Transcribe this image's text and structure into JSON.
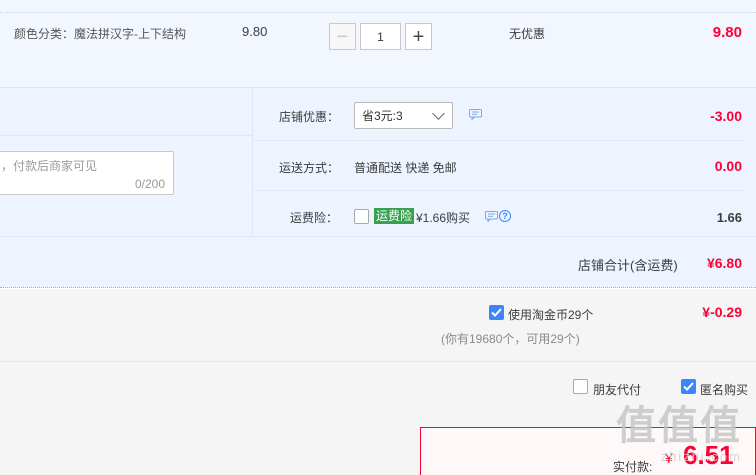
{
  "item": {
    "attr_label": "颜色分类：",
    "attr_value": "魔法拼汉字-上下结构",
    "unit_price": "9.80",
    "quantity": "1",
    "minus_glyph": "−",
    "plus_glyph": "+",
    "discount_text": "无优惠",
    "total": "9.80"
  },
  "store": {
    "memo_placeholder": "，付款后商家可见",
    "memo_count": "0/200",
    "coupon_label": "店铺优惠：",
    "coupon_selected": "省3元:3",
    "coupon_amount": "-3.00",
    "shipping_label": "运送方式：",
    "shipping_value": "普通配送 快递 免邮",
    "shipping_amount": "0.00",
    "insurance_label": "运费险：",
    "insurance_tag": "运费险",
    "insurance_price": "¥1.66购买",
    "insurance_amount": "1.66",
    "help_glyph": "?",
    "store_total_label": "店铺合计(含运费)",
    "store_total": "¥6.80"
  },
  "bottom": {
    "gold_label": "使用淘金币29个",
    "gold_amount": "¥-0.29",
    "gold_sub": "(你有19680个，可用29个)",
    "friend_pay_label": "朋友代付",
    "anonymous_label": "匿名购买",
    "pay_label": "实付款:",
    "pay_yen": "¥",
    "pay_amount": "6.51"
  },
  "watermark": {
    "logo": "值值值",
    "url": "zhizhi.com"
  },
  "colors": {
    "accent_red": "#ff0036",
    "checkbox_blue": "#3b86ff",
    "tag_green": "#37a14f",
    "panel_bg": "#eef4ff"
  }
}
